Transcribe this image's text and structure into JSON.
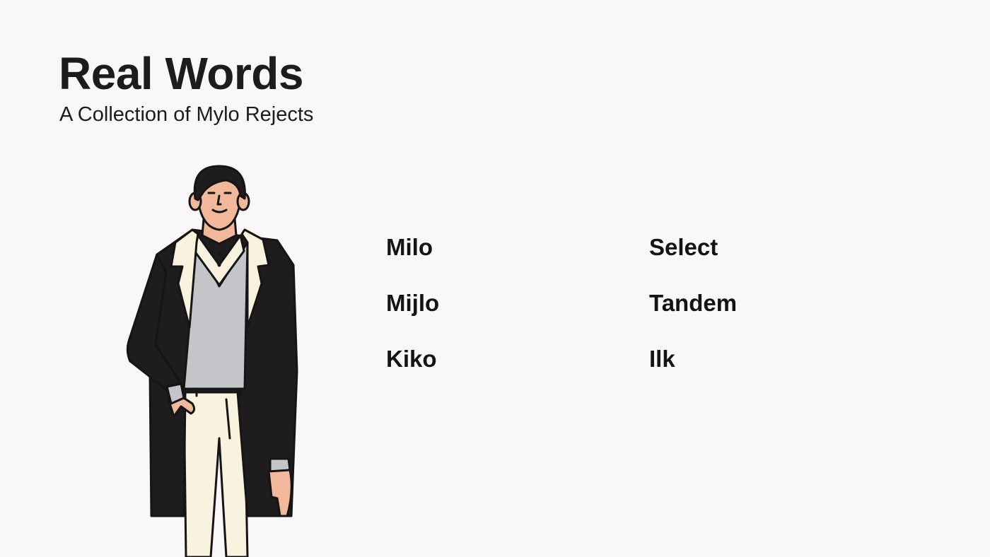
{
  "slide": {
    "title": "Real Words",
    "subtitle": "A Collection of Mylo Rejects",
    "background_color": "#f9f7f8",
    "words": [
      {
        "label": "Milo"
      },
      {
        "label": "Mijlo"
      },
      {
        "label": "Kiko"
      },
      {
        "label": "Select"
      },
      {
        "label": "Tandem"
      },
      {
        "label": "Ilk"
      }
    ],
    "illustration": {
      "icon": "man-in-coat-illustration",
      "colors": {
        "coat": "#1e1c1d",
        "lapel": "#f8f2df",
        "sweater": "#c3c5c8",
        "skin": "#f2b89c",
        "hair": "#1e1c1d",
        "trousers": "#f8f2df",
        "outline": "#151515"
      }
    }
  }
}
